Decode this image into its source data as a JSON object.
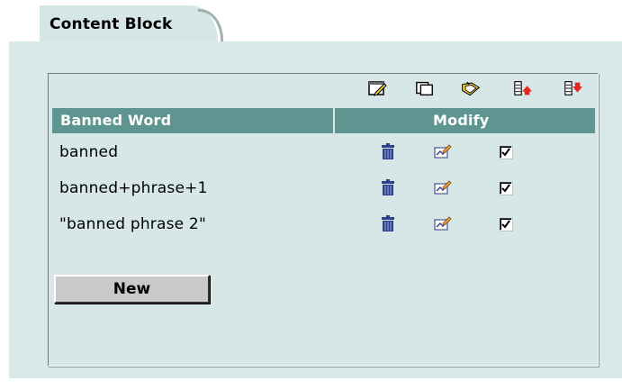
{
  "tab": {
    "title": "Content Block"
  },
  "toolbar": {
    "icons": [
      "edit-selected-icon",
      "window-icon",
      "clear-icon",
      "import-icon",
      "export-icon"
    ]
  },
  "table": {
    "headers": {
      "word": "Banned Word",
      "modify": "Modify"
    },
    "rows": [
      {
        "word": "banned",
        "enabled": true
      },
      {
        "word": "banned+phrase+1",
        "enabled": true
      },
      {
        "word": "\"banned phrase 2\"",
        "enabled": true
      }
    ]
  },
  "buttons": {
    "new_label": "New"
  },
  "colors": {
    "panel_bg": "#d9e9e9",
    "header_bg": "#5f9590",
    "delete_icon": "#2b3f8c",
    "import_red": "#e8241c"
  }
}
